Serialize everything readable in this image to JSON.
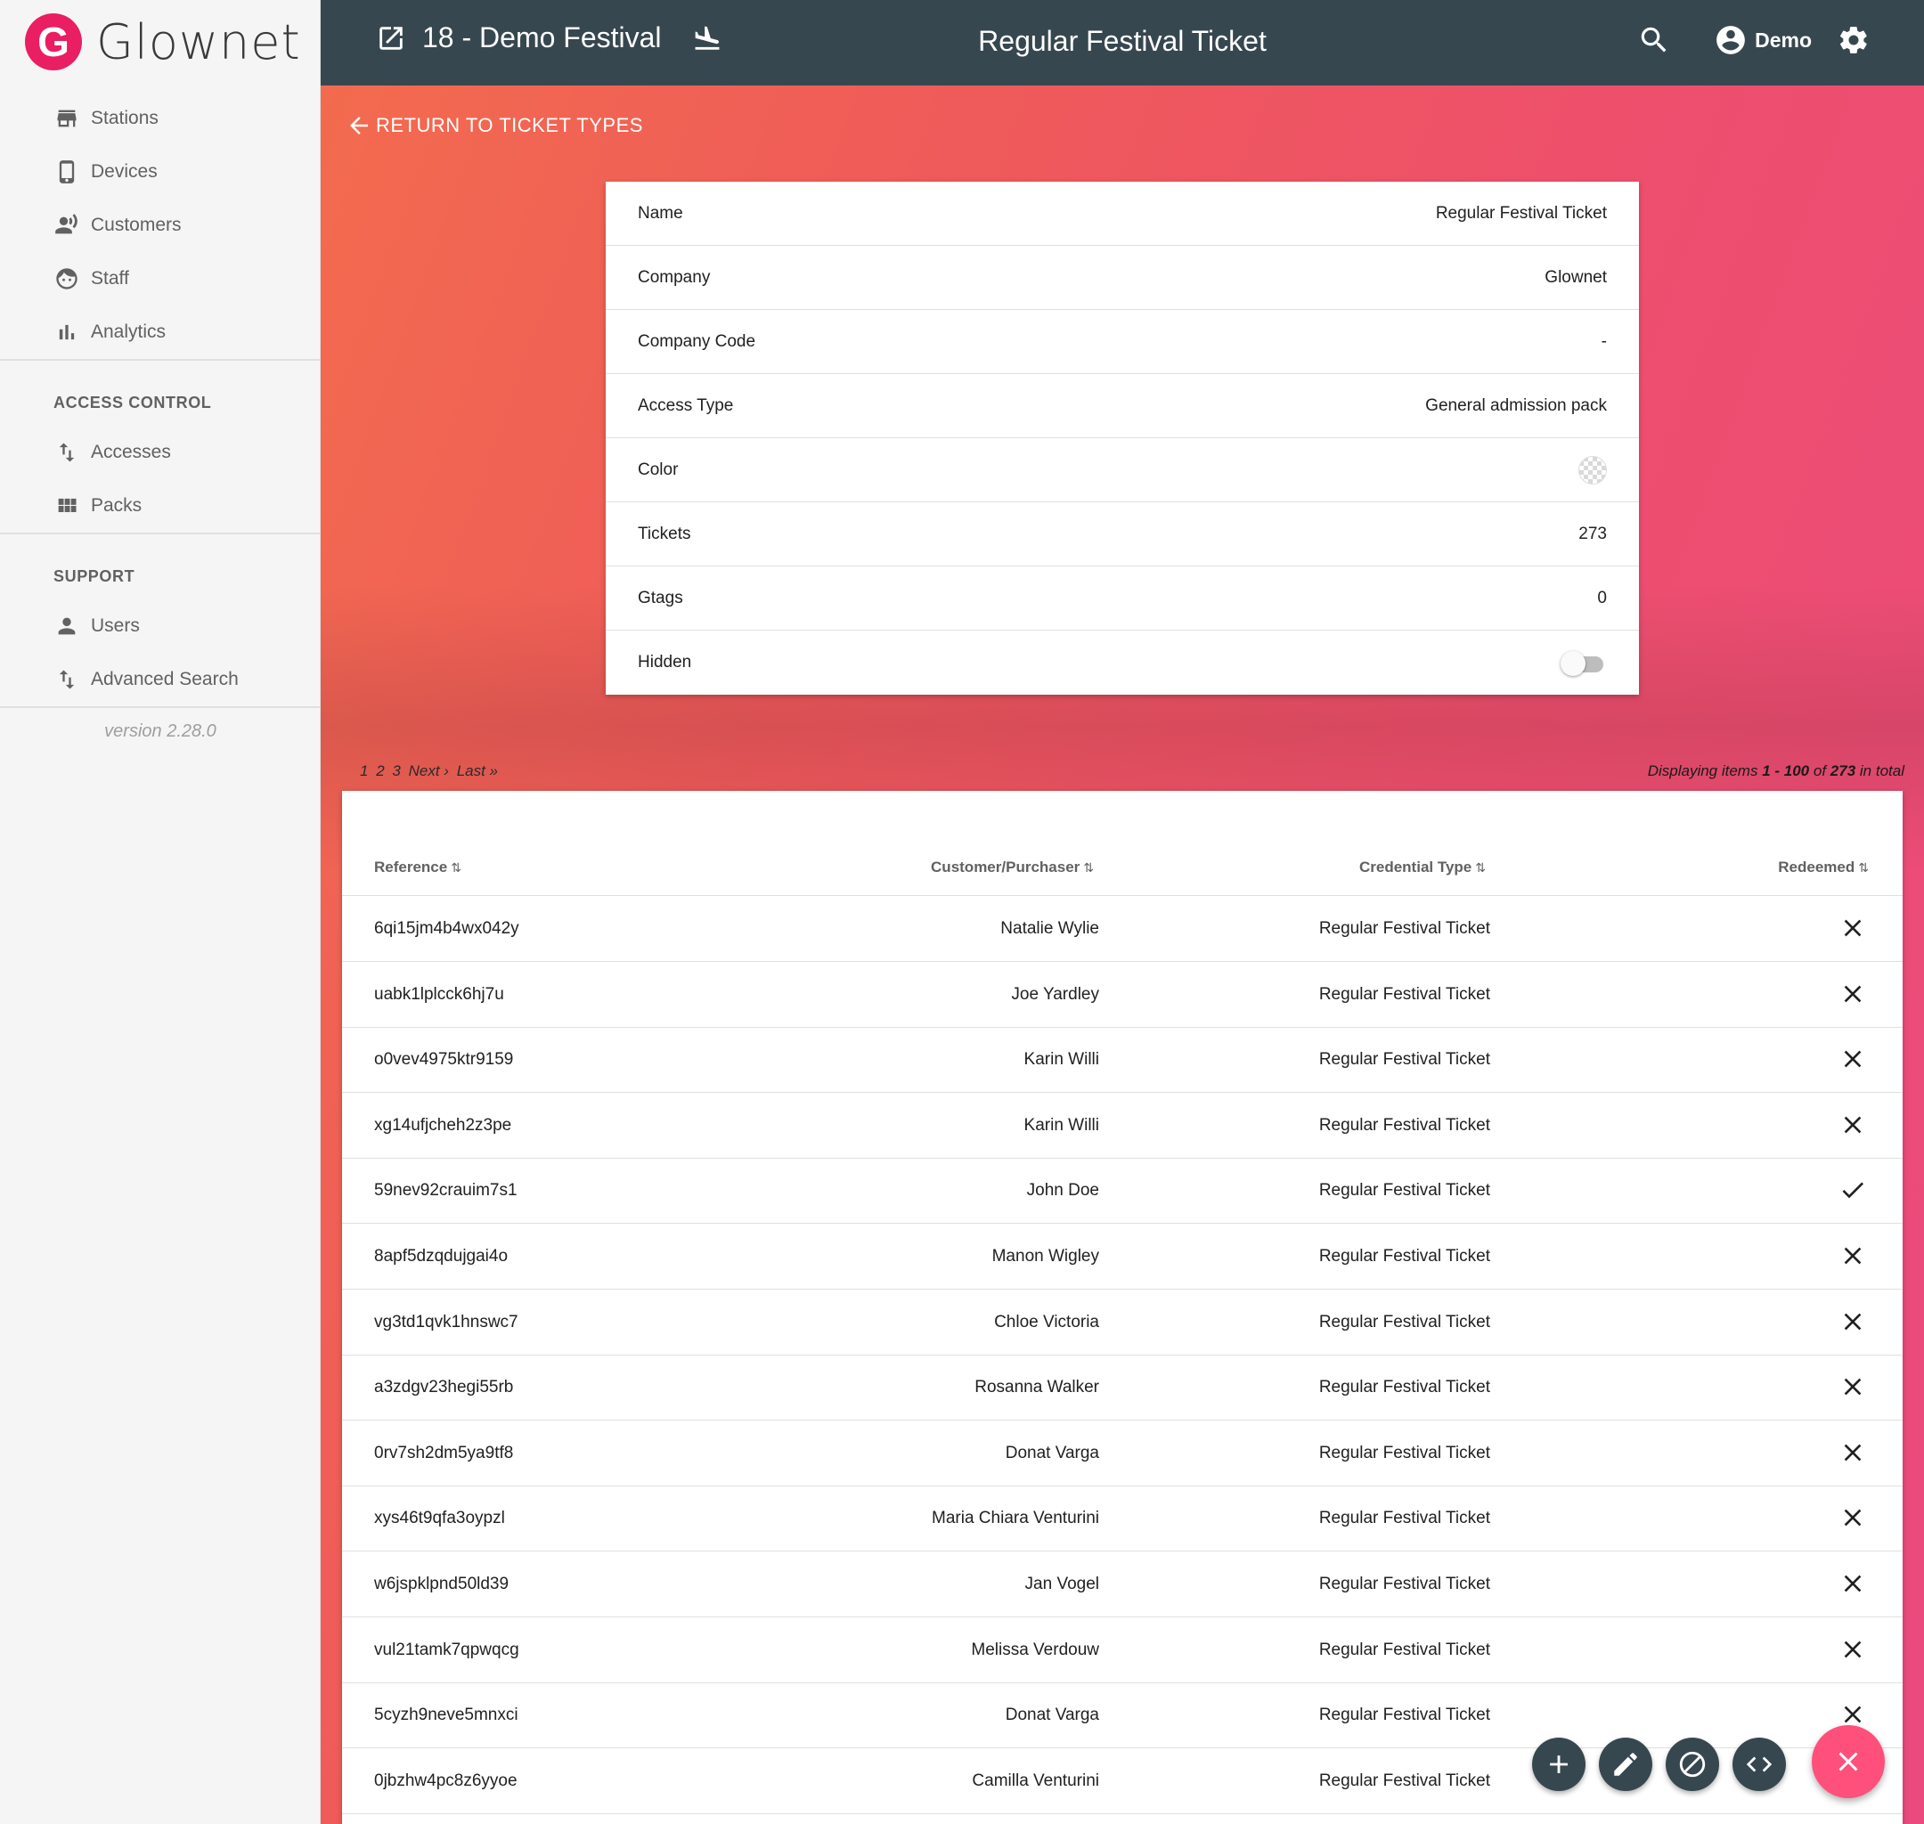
{
  "sidebar": {
    "logo_letter": "G",
    "brand": "Glownet",
    "items": [
      {
        "label": "Stations",
        "icon": "store-icon"
      },
      {
        "label": "Devices",
        "icon": "phone-icon"
      },
      {
        "label": "Customers",
        "icon": "customers-icon"
      },
      {
        "label": "Staff",
        "icon": "face-icon"
      },
      {
        "label": "Analytics",
        "icon": "bar-chart-icon"
      }
    ],
    "access_control_title": "ACCESS CONTROL",
    "access_items": [
      {
        "label": "Accesses",
        "icon": "import-export-icon"
      },
      {
        "label": "Packs",
        "icon": "grid-icon"
      }
    ],
    "support_title": "SUPPORT",
    "support_items": [
      {
        "label": "Users",
        "icon": "person-icon"
      },
      {
        "label": "Advanced Search",
        "icon": "import-export-icon"
      }
    ],
    "version": "version 2.28.0"
  },
  "topbar": {
    "event_name": "18 - Demo Festival",
    "page_title": "Regular Festival Ticket",
    "user_name": "Demo"
  },
  "main": {
    "return_label": "RETURN TO TICKET TYPES"
  },
  "details": [
    {
      "label": "Name",
      "value": "Regular Festival Ticket"
    },
    {
      "label": "Company",
      "value": "Glownet"
    },
    {
      "label": "Company Code",
      "value": "-"
    },
    {
      "label": "Access Type",
      "value": "General admission pack"
    },
    {
      "label": "Color",
      "value": ""
    },
    {
      "label": "Tickets",
      "value": "273"
    },
    {
      "label": "Gtags",
      "value": "0"
    },
    {
      "label": "Hidden",
      "value": ""
    }
  ],
  "hidden_toggle_on": false,
  "pagination": {
    "pages": [
      "1",
      "2",
      "3"
    ],
    "next": "Next ›",
    "last": "Last »",
    "display_prefix": "Displaying items",
    "display_range": "1 - 100",
    "display_of": "of",
    "display_total": "273",
    "display_suffix": "in total"
  },
  "table": {
    "headers": [
      "Reference",
      "Customer/Purchaser",
      "Credential Type",
      "Redeemed"
    ],
    "sort_glyph": "⇅",
    "rows": [
      {
        "reference": "6qi15jm4b4wx042y",
        "customer": "Natalie Wylie",
        "credential_type": "Regular Festival Ticket",
        "redeemed": false
      },
      {
        "reference": "uabk1lplcck6hj7u",
        "customer": "Joe Yardley",
        "credential_type": "Regular Festival Ticket",
        "redeemed": false
      },
      {
        "reference": "o0vev4975ktr9159",
        "customer": "Karin Willi",
        "credential_type": "Regular Festival Ticket",
        "redeemed": false
      },
      {
        "reference": "xg14ufjcheh2z3pe",
        "customer": "Karin Willi",
        "credential_type": "Regular Festival Ticket",
        "redeemed": false
      },
      {
        "reference": "59nev92crauim7s1",
        "customer": "John Doe",
        "credential_type": "Regular Festival Ticket",
        "redeemed": true
      },
      {
        "reference": "8apf5dzqdujgai4o",
        "customer": "Manon Wigley",
        "credential_type": "Regular Festival Ticket",
        "redeemed": false
      },
      {
        "reference": "vg3td1qvk1hnswc7",
        "customer": "Chloe Victoria",
        "credential_type": "Regular Festival Ticket",
        "redeemed": false
      },
      {
        "reference": "a3zdgv23hegi55rb",
        "customer": "Rosanna Walker",
        "credential_type": "Regular Festival Ticket",
        "redeemed": false
      },
      {
        "reference": "0rv7sh2dm5ya9tf8",
        "customer": "Donat Varga",
        "credential_type": "Regular Festival Ticket",
        "redeemed": false
      },
      {
        "reference": "xys46t9qfa3oypzl",
        "customer": "Maria Chiara Venturini",
        "credential_type": "Regular Festival Ticket",
        "redeemed": false
      },
      {
        "reference": "w6jspklpnd50ld39",
        "customer": "Jan Vogel",
        "credential_type": "Regular Festival Ticket",
        "redeemed": false
      },
      {
        "reference": "vul21tamk7qpwqcg",
        "customer": "Melissa Verdouw",
        "credential_type": "Regular Festival Ticket",
        "redeemed": false
      },
      {
        "reference": "5cyzh9neve5mnxci",
        "customer": "Donat Varga",
        "credential_type": "Regular Festival Ticket",
        "redeemed": false
      },
      {
        "reference": "0jbzhw4pc8z6yyoe",
        "customer": "Camilla Venturini",
        "credential_type": "Regular Festival Ticket",
        "redeemed": false
      }
    ]
  },
  "fabs": [
    "add-icon",
    "edit-icon",
    "block-icon",
    "code-icon",
    "close-icon"
  ],
  "colors": {
    "topbar": "#37474f",
    "accent": "#e91e63",
    "fab_main": "#ff4f7b",
    "background_gradient_start": "#f26b4e",
    "background_gradient_end": "#ea4a7e"
  }
}
